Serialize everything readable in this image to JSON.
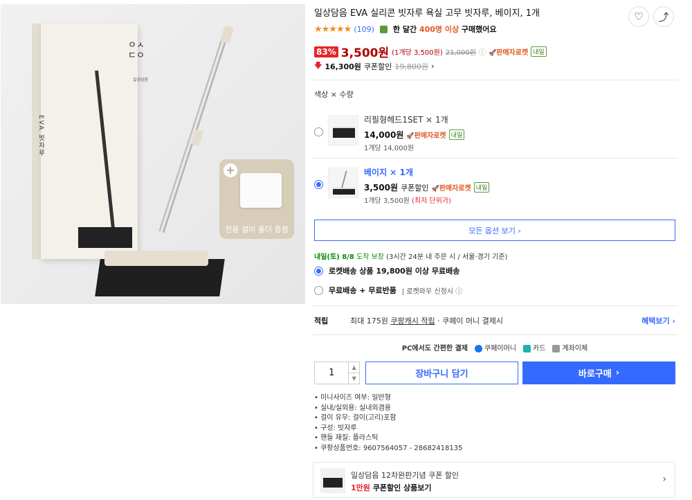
{
  "product": {
    "title": "일상담음 EVA 실리콘 빗자루 욕실 고무 빗자루, 베이지, 1개",
    "gift_label": "전용 걸이 홀더 증정",
    "box_logo": "ㅇㅅ\nㄷㅇ",
    "box_brand": "일상담음",
    "box_side_text": "EVA 빗자루"
  },
  "rating": {
    "stars": "★★★★★",
    "review_count": "(109)",
    "buy_prefix": "한 달간",
    "buy_count": "400명 이상",
    "buy_suffix": "구매했어요"
  },
  "price": {
    "discount": "83%",
    "sale": "3,500원",
    "unit": "(1개당 3,500원)",
    "original": "21,000원",
    "info_icon": "ⓘ",
    "seller_rocket": "판매자로켓",
    "tomorrow": "내일",
    "coupon_price": "16,300원",
    "coupon_text": "쿠폰할인",
    "coupon_orig": "19,800원",
    "coupon_chevron": "›"
  },
  "options": {
    "label": "색상 × 수량",
    "items": [
      {
        "name": "리필형헤드1SET × 1개",
        "price": "14,000원",
        "coupon": "",
        "rocket": "판매자로켓",
        "tomorrow": "내일",
        "unit": "1개당 14,000원",
        "lowest": ""
      },
      {
        "name": "베이지 × 1개",
        "price": "3,500원",
        "coupon": "쿠폰할인",
        "rocket": "판매자로켓",
        "tomorrow": "내일",
        "unit": "1개당 3,500원",
        "lowest": "(최저 단위가)"
      }
    ],
    "all_button": "모든 옵션 보기 ›"
  },
  "shipping": {
    "arrival_day": "내일(토) 8/8",
    "arrival_text": "도착 보장",
    "arrival_note": "(3시간 24분 내 주문 시 / 서울·경기 기준)",
    "opt1": "로켓배송 상품 19,800원 이상 무료배송",
    "opt2_bold": "무료배송 + 무료반품",
    "opt2_sub": "| 로켓와우 신청시 ⓘ"
  },
  "points": {
    "label": "적립",
    "text_prefix": "최대 175원",
    "text_link": "쿠팡캐시 적립",
    "text_suffix": "· 쿠페이 머니 결제시",
    "benefit": "혜택보기 ›"
  },
  "payment": {
    "title": "PC에서도 간편한 결제",
    "methods": [
      "쿠페이머니",
      "카드",
      "계좌이체"
    ],
    "colors": [
      "#1a73e8",
      "#20b2aa",
      "#999999"
    ]
  },
  "purchase": {
    "quantity": "1",
    "cart": "장바구니 담기",
    "buy": "바로구매",
    "buy_arrow": "›"
  },
  "specs": [
    "미니사이즈 여부: 일반형",
    "실내/실외용: 실내외겸용",
    "걸이 유무: 걸이(고리)포함",
    "구성: 빗자루",
    "핸들 재질: 플라스틱",
    "쿠팡상품번호: 9607564057 - 28682418135"
  ],
  "promo": {
    "line1": "일상담음 12차완판기념 쿠폰 할인",
    "amount": "1만원",
    "line2": "쿠폰할인 상품보기",
    "arrow": "›"
  },
  "icons": {
    "heart": "♡",
    "share": "⤴"
  },
  "colors": {
    "accent": "#346aff",
    "sale": "#ae0000",
    "rocket": "#e2571f"
  }
}
